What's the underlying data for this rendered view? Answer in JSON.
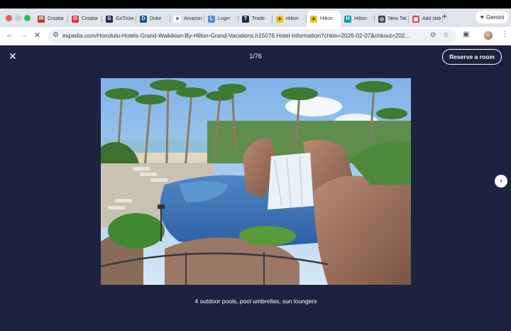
{
  "browser": {
    "tabs": [
      {
        "label": "Croatia",
        "favicon": "red-square-icon",
        "color": "#c0392b",
        "glyph": "IR"
      },
      {
        "label": "Croatia",
        "favicon": "opera-icon",
        "color": "#e03a3a",
        "glyph": "O"
      },
      {
        "label": "GoTickets",
        "favicon": "gotickets-icon",
        "color": "#1f2b4d",
        "glyph": "G"
      },
      {
        "label": "Duke",
        "favicon": "duke-icon",
        "color": "#1d4f91",
        "glyph": "D"
      },
      {
        "label": "Amazon",
        "favicon": "amazon-icon",
        "color": "#ffffff",
        "glyph": "a"
      },
      {
        "label": "Login",
        "favicon": "login-icon",
        "color": "#4a90d9",
        "glyph": "L"
      },
      {
        "label": "Trade",
        "favicon": "trade-icon",
        "color": "#1f2b4d",
        "glyph": "T"
      },
      {
        "label": "Hilton",
        "favicon": "expedia-icon",
        "color": "#f7c600",
        "glyph": "✈"
      },
      {
        "label": "Hilton",
        "favicon": "expedia-icon",
        "color": "#f7c600",
        "glyph": "✈",
        "active": true
      },
      {
        "label": "Hilton",
        "favicon": "hilton-icon",
        "color": "#00a3ad",
        "glyph": "H"
      },
      {
        "label": "New Tab",
        "favicon": "chrome-icon",
        "color": "#444444",
        "glyph": "◎"
      },
      {
        "label": "Add slides",
        "favicon": "slides-icon",
        "color": "#e8445a",
        "glyph": "▣"
      }
    ],
    "new_tab_glyph": "+",
    "gemini_label": "Gemini",
    "url": "expedia.com/Honolulu-Hotels-Grand-Waikikian-By-Hilton-Grand-Vacations.h15076.Hotel-Information?chkin=2026-02-07&chkout=202..."
  },
  "gallery": {
    "close_glyph": "✕",
    "counter": "1/76",
    "reserve_label": "Reserve a room",
    "next_glyph": "›",
    "caption": "4 outdoor pools, pool umbrellas, sun loungers"
  },
  "colors": {
    "overlay_bg": "#1c2340",
    "tabbar_bg": "#dfe3ea"
  }
}
